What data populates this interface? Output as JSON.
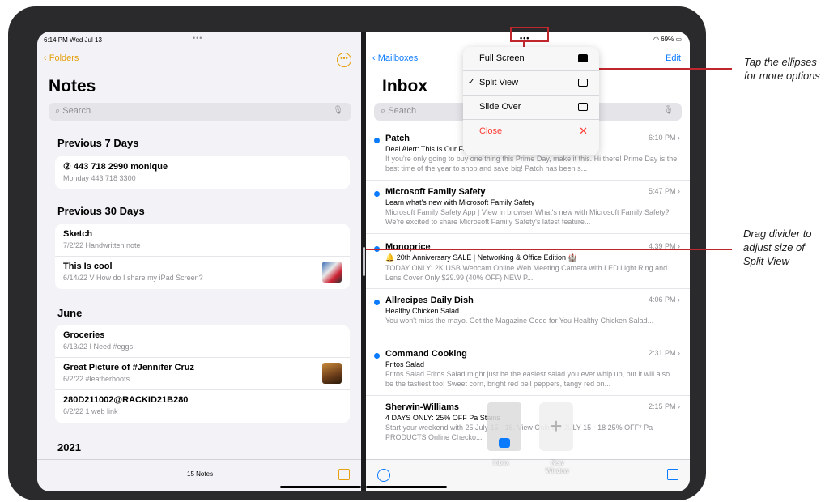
{
  "status": {
    "time": "6:14 PM  Wed Jul 13",
    "battery": "69%",
    "dots": "•••"
  },
  "notes": {
    "back_label": "Folders",
    "more_icon": "•••",
    "title": "Notes",
    "search_placeholder": "Search",
    "sections": [
      {
        "header": "Previous 7 Days",
        "items": [
          {
            "title": "443 718 2990 monique",
            "sub": "Monday  443 718 3300"
          }
        ]
      },
      {
        "header": "Previous 30 Days",
        "items": [
          {
            "title": "Sketch",
            "sub": "7/2/22  Handwritten note"
          },
          {
            "title": "This Is cool",
            "sub": "6/14/22  V How do I share my iPad Screen?"
          }
        ]
      },
      {
        "header": "June",
        "items": [
          {
            "title": "Groceries",
            "sub": "6/13/22  I Need #eggs"
          },
          {
            "title": "Great Picture of #Jennifer Cruz",
            "sub": "6/2/22  #leatherboots"
          },
          {
            "title": "280D211002@RACKID21B280",
            "sub": "6/2/22  1 web link"
          }
        ]
      },
      {
        "header": "2021",
        "items": []
      }
    ],
    "count": "15 Notes"
  },
  "mail": {
    "back_label": "Mailboxes",
    "edit_label": "Edit",
    "title": "Inbox",
    "search_placeholder": "Search",
    "messages": [
      {
        "sender": "Patch",
        "time": "6:10 PM",
        "subject": "Deal Alert: This Is Our Favorite Deal Of Prime Day 2022",
        "preview": "If you're only going to buy one thing this Prime Day, make it this. Hi there! Prime Day is the best time of the year to shop and save big! Patch has been s..."
      },
      {
        "sender": "Microsoft Family Safety",
        "time": "5:47 PM",
        "subject": "Learn what's new with Microsoft Family Safety",
        "preview": "Microsoft Family Safety App | View in browser What's new with Microsoft Family Safety? We're excited to share Microsoft Family Safety's latest feature..."
      },
      {
        "sender": "Monoprice",
        "time": "4:39 PM",
        "subject": "🔔 20th Anniversary SALE | Networking & Office Edition 🏰",
        "preview": "TODAY ONLY: 2K USB Webcam Online Web Meeting Camera with LED Light Ring and Lens Cover Only $29.99 (40% OFF)                                NEW P..."
      },
      {
        "sender": "Allrecipes Daily Dish",
        "time": "4:06 PM",
        "subject": "Healthy Chicken Salad",
        "preview": "You won't miss the mayo. Get the Magazine Good for You Healthy Chicken Salad..."
      },
      {
        "sender": "Command Cooking",
        "time": "2:31 PM",
        "subject": "Fritos Salad",
        "preview": "Fritos Salad Fritos Salad might just be the easiest salad you ever whip up, but it will also be the tastiest too! Sweet corn, bright red bell peppers, tangy red on..."
      },
      {
        "sender": "Sherwin-Williams",
        "time": "2:15 PM",
        "subject": "4 DAYS ONLY: 25% OFF Pa                   Stains",
        "preview": "Start your weekend with 25                              July 15 - 18. View Online » JULY 15 - 18 25% OFF* Pa                              PRODUCTS Online Checko..."
      }
    ]
  },
  "menu": {
    "items": [
      {
        "label": "Full Screen",
        "checked": false
      },
      {
        "label": "Split View",
        "checked": true
      },
      {
        "label": "Slide Over",
        "checked": false
      }
    ],
    "close_label": "Close",
    "check_mark": "✓"
  },
  "switcher": {
    "inbox_label": "Inbox",
    "new_window_label": "New\nWindow"
  },
  "callouts": {
    "ellipses": "Tap the ellipses for more options",
    "divider": "Drag divider to adjust size of Split View"
  },
  "colors": {
    "notes_accent": "#e5a00d",
    "mail_accent": "#0a7aff",
    "annotation": "#c0272d"
  }
}
